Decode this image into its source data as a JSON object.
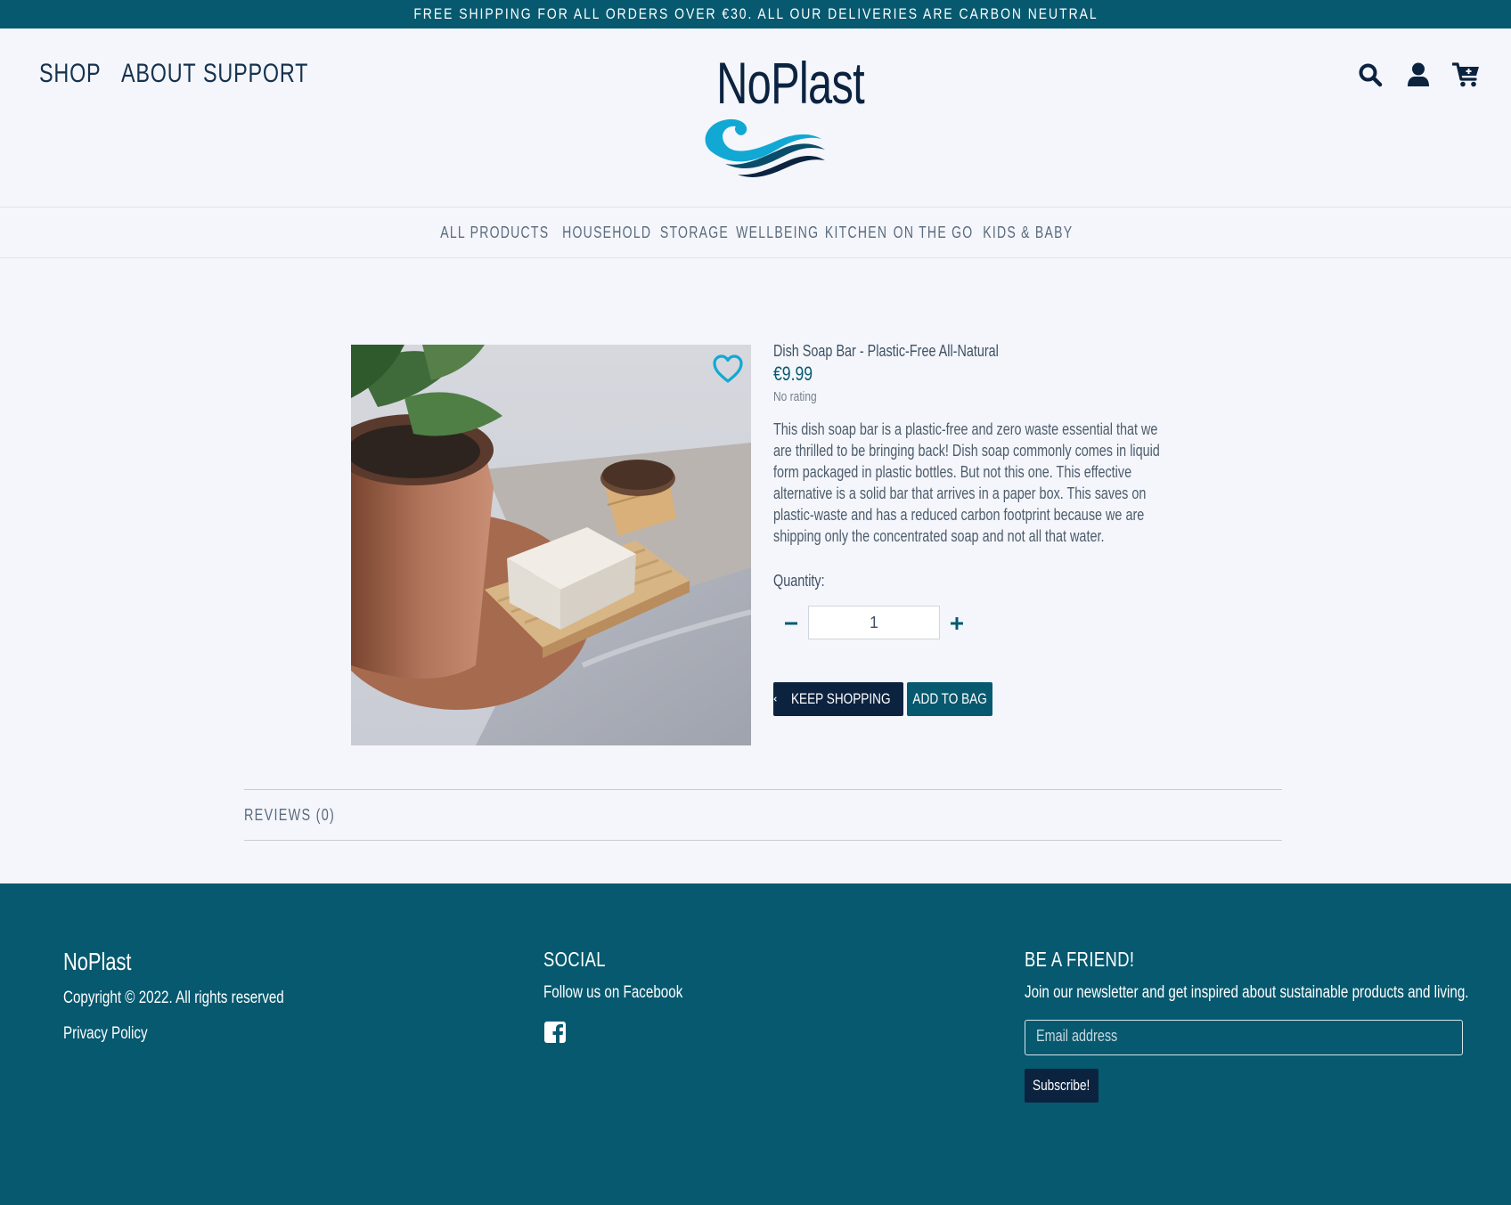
{
  "promo_banner": "FREE SHIPPING FOR ALL ORDERS OVER €30. ALL OUR DELIVERIES ARE CARBON NEUTRAL",
  "header": {
    "nav": [
      "SHOP",
      "ABOUT",
      "SUPPORT"
    ],
    "logo_text": "NoPlast",
    "icons": [
      "search-icon",
      "user-icon",
      "cart-icon"
    ]
  },
  "categories": [
    "ALL PRODUCTS",
    "HOUSEHOLD",
    "STORAGE",
    "WELLBEING",
    "KITCHEN",
    "ON THE GO",
    "KIDS & BABY"
  ],
  "product": {
    "title": "Dish Soap Bar - Plastic-Free All-Natural",
    "price": "€9.99",
    "rating": "No rating",
    "description": "This dish soap bar is a plastic-free and zero waste essential that we are thrilled to be bringing back! Dish soap commonly comes in liquid form packaged in plastic bottles. But not this one. This effective alternative is a solid bar that arrives in a paper box. This saves on plastic-waste and has a reduced carbon footprint because we are shipping only the concentrated soap and not all that water.",
    "quantity_label": "Quantity:",
    "quantity_value": "1",
    "keep_shopping_label": "KEEP SHOPPING",
    "add_to_bag_label": "ADD TO BAG"
  },
  "reviews_label": "REVIEWS (0)",
  "footer": {
    "brand": "NoPlast",
    "copyright": "Copyright © 2022. All rights reserved",
    "privacy": "Privacy Policy",
    "social_heading": "SOCIAL",
    "social_text": "Follow us on Facebook",
    "friend_heading": "BE A FRIEND!",
    "friend_text": "Join our newsletter and get inspired about sustainable products and living.",
    "email_placeholder": "Email address",
    "subscribe_label": "Subscribe!"
  },
  "colors": {
    "primary_teal": "#06596f",
    "navy": "#0c2340",
    "accent_cyan": "#12a8d4",
    "page_bg": "#f4f6fb"
  }
}
